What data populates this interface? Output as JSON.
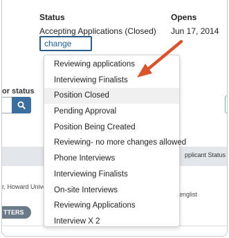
{
  "job": {
    "status_label": "Status",
    "status_value": "Accepting Applications (Closed)",
    "opens_label": "Opens",
    "opens_value": "Jun 17, 2014",
    "change_label": "change"
  },
  "filter": {
    "label": "or status",
    "search_icon": "search-icon"
  },
  "table": {
    "header_right": "pplicant Status",
    "row_left": "r, Howard Unive",
    "row_right": "englist",
    "pill_label": "TTERS"
  },
  "dropdown": {
    "selected_index": 2,
    "items": [
      "Reviewing applications",
      "Interviewing Finalists",
      "Position Closed",
      "Pending Approval",
      "Position Being Created",
      "Reviewing- no more changes allowed",
      "Phone Interviews",
      "Interviewing Finalists",
      "On-site Interviews",
      "Reviewing Applications",
      "Interview X 2"
    ]
  },
  "colors": {
    "accent": "#2a5a8a",
    "arrow": "#d9532b",
    "link": "#1f5e9a"
  }
}
